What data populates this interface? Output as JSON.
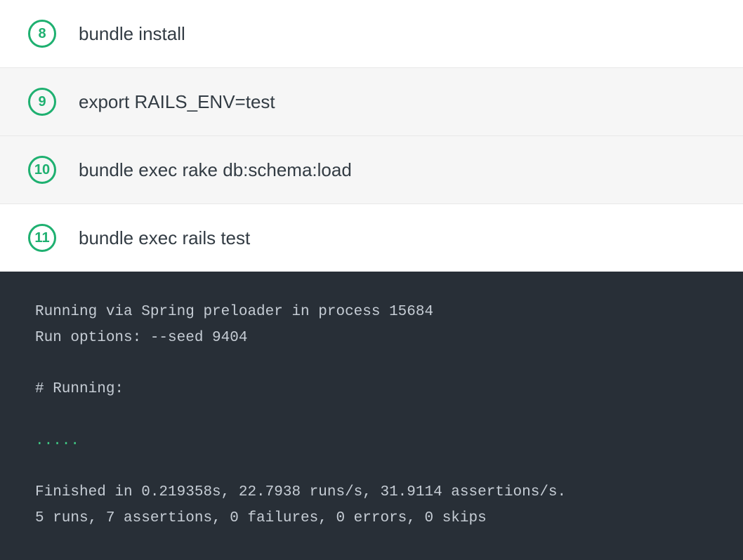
{
  "steps": [
    {
      "num": "8",
      "label": "bundle install",
      "bg": "white"
    },
    {
      "num": "9",
      "label": "export RAILS_ENV=test",
      "bg": "gray"
    },
    {
      "num": "10",
      "label": "bundle exec rake db:schema:load",
      "bg": "gray"
    },
    {
      "num": "11",
      "label": "bundle exec rails test",
      "bg": "white"
    }
  ],
  "terminal": {
    "line1": "Running via Spring preloader in process 15684",
    "line2": "Run options: --seed 9404",
    "line3": "# Running:",
    "dots": ".....",
    "line4": "Finished in 0.219358s, 22.7938 runs/s, 31.9114 assertions/s.",
    "line5": "5 runs, 7 assertions, 0 failures, 0 errors, 0 skips"
  }
}
